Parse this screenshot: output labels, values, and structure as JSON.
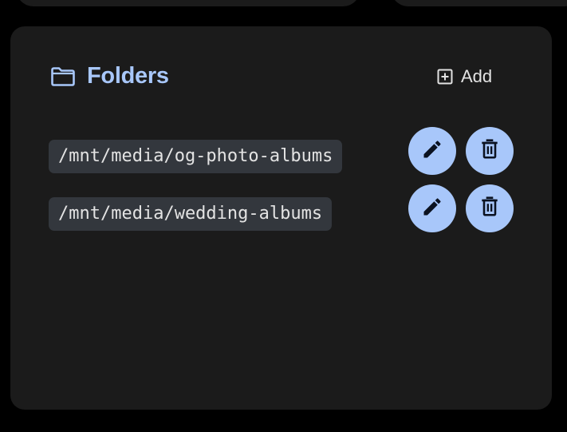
{
  "colors": {
    "page_background": "#000000",
    "card_background": "#1b1b1b",
    "accent": "#a8c7fa",
    "chip_background": "#33373d",
    "text": "#e3e3e3"
  },
  "folders_card": {
    "title": "Folders",
    "title_icon": "folder-icon",
    "add_label": "Add",
    "add_icon": "plus-box-icon",
    "folders": [
      {
        "path": "/mnt/media/og-photo-albums",
        "edit_icon": "pencil-icon",
        "delete_icon": "trash-icon"
      },
      {
        "path": "/mnt/media/wedding-albums",
        "edit_icon": "pencil-icon",
        "delete_icon": "trash-icon"
      }
    ]
  }
}
